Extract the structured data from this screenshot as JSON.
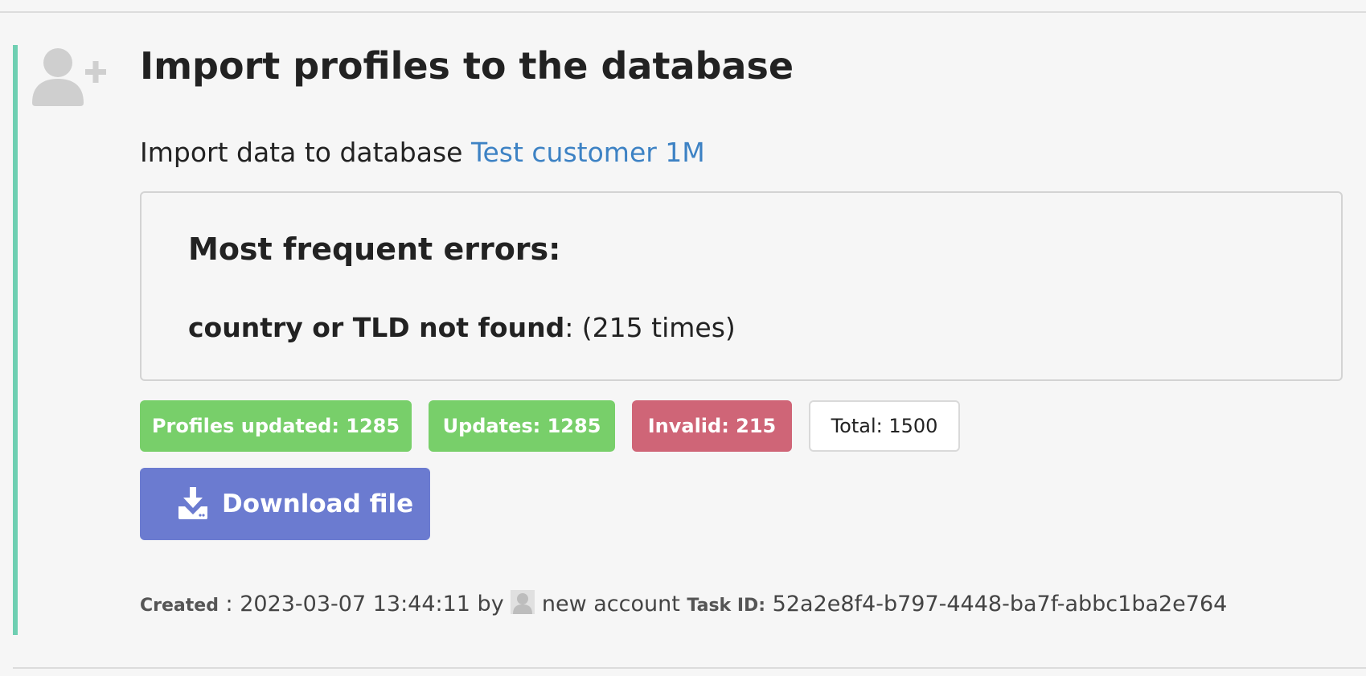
{
  "header": {
    "title": "Import profiles to the database",
    "icon": "user-add-icon"
  },
  "subtitle": {
    "prefix": "Import data to database ",
    "database_link": "Test customer 1M"
  },
  "errors": {
    "heading": "Most frequent errors:",
    "items": [
      {
        "message": "country or TLD not found",
        "count_text": ": (215 times)"
      }
    ]
  },
  "badges": {
    "profiles_updated": "Profiles updated: 1285",
    "updates": "Updates: 1285",
    "invalid": "Invalid: 215",
    "total": "Total: 1500"
  },
  "download": {
    "label": "Download file",
    "icon": "download-icon"
  },
  "meta": {
    "created_label": "Created",
    "created_sep": " : 2023-03-07 13:44:11 by ",
    "author": "new account",
    "task_id_label": "Task ID:",
    "task_id": "52a2e8f4-b797-4448-ba7f-abbc1ba2e764"
  },
  "colors": {
    "accent": "#6fcfb2",
    "link": "#3d82c4",
    "success": "#78cf6a",
    "danger": "#cf6577",
    "primary": "#6b7bd0"
  }
}
